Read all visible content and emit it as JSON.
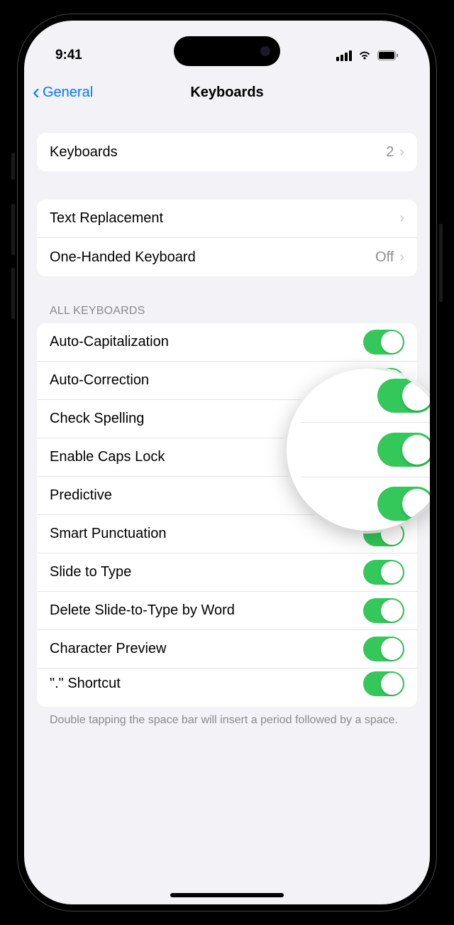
{
  "status": {
    "time": "9:41"
  },
  "nav": {
    "back_label": "General",
    "title": "Keyboards"
  },
  "group1": {
    "keyboards": {
      "label": "Keyboards",
      "value": "2"
    }
  },
  "group2": {
    "text_replacement": {
      "label": "Text Replacement"
    },
    "one_handed": {
      "label": "One-Handed Keyboard",
      "value": "Off"
    }
  },
  "section_header": "ALL KEYBOARDS",
  "toggles": {
    "auto_cap": {
      "label": "Auto-Capitalization",
      "on": true
    },
    "auto_correct": {
      "label": "Auto-Correction",
      "on": true
    },
    "check_spell": {
      "label": "Check Spelling",
      "on": true
    },
    "caps_lock": {
      "label": "Enable Caps Lock",
      "on": true
    },
    "predictive": {
      "label": "Predictive",
      "on": true
    },
    "smart_punc": {
      "label": "Smart Punctuation",
      "on": true
    },
    "slide_type": {
      "label": "Slide to Type",
      "on": true
    },
    "del_slide": {
      "label": "Delete Slide-to-Type by Word",
      "on": true
    },
    "char_preview": {
      "label": "Character Preview",
      "on": true
    },
    "period_shortcut": {
      "label": "\".\" Shortcut",
      "on": true
    }
  },
  "footer": "Double tapping the space bar will insert a period followed by a space.",
  "colors": {
    "accent": "#007aff",
    "toggle_on": "#34c759",
    "bg": "#f2f2f7",
    "secondary_text": "#8e8e93"
  }
}
